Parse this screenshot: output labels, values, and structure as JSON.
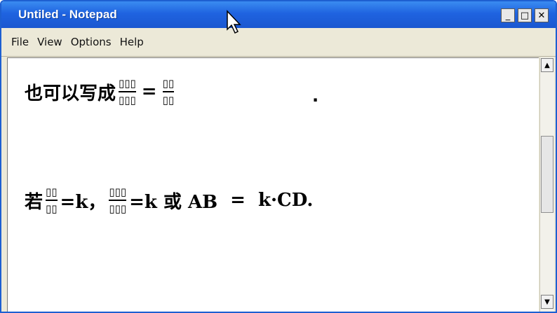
{
  "window": {
    "title": "Untiled - Notepad",
    "buttons": {
      "minimize": "_",
      "maximize": "□",
      "close": "✕"
    }
  },
  "menu": [
    "File",
    "View",
    "Options",
    "Help"
  ],
  "content": {
    "line1": {
      "prefix": "也可以写成",
      "frac1": {
        "num": "▯▯▯",
        "den": "▯▯▯"
      },
      "equals": "=",
      "frac2": {
        "num": "▯▯",
        "den": "▯▯"
      },
      "trailing": "."
    },
    "line2": {
      "ruo": "若",
      "frac1": {
        "num": "▯▯",
        "den": "▯▯"
      },
      "eq_k1": "=k，",
      "frac2": {
        "num": "▯▯▯",
        "den": "▯▯▯"
      },
      "eq_k2": "=k 或 AB",
      "eq": "=",
      "kcd": "k·CD."
    }
  },
  "scrollbar": {
    "up": "▲",
    "down": "▼"
  }
}
